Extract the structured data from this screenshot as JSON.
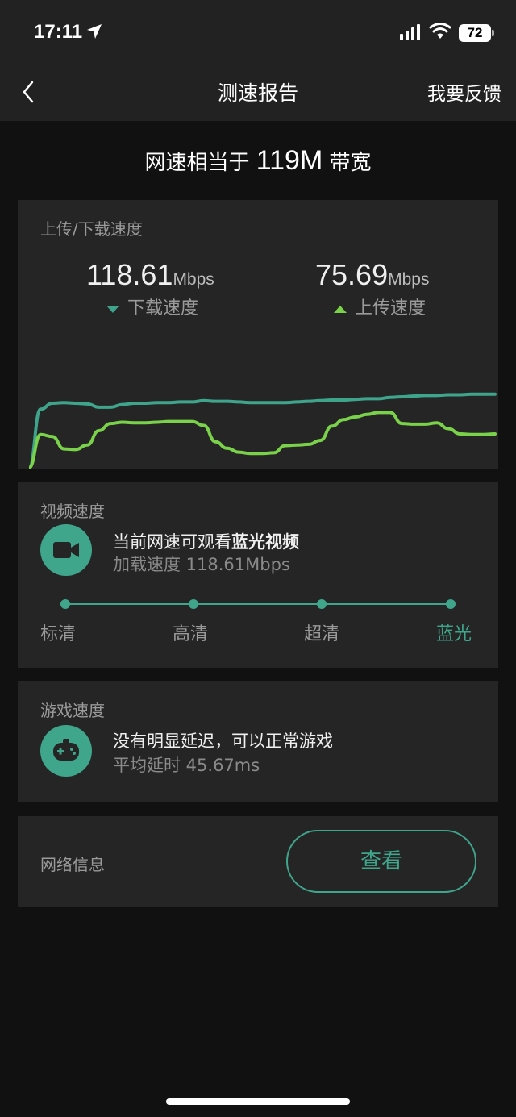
{
  "status_bar": {
    "time": "17:11",
    "battery": "72"
  },
  "nav": {
    "title": "测速报告",
    "feedback": "我要反馈"
  },
  "headline": {
    "prefix": "网速相当于 ",
    "bandwidth": "119M",
    "suffix": " 带宽"
  },
  "speed_card": {
    "title": "上传/下载速度",
    "download": {
      "value": "118.61",
      "unit": "Mbps",
      "label": "下载速度"
    },
    "upload": {
      "value": "75.69",
      "unit": "Mbps",
      "label": "上传速度"
    }
  },
  "chart_data": {
    "type": "line",
    "title": "",
    "xlabel": "",
    "ylabel": "",
    "x": [
      0,
      1,
      2,
      3,
      4,
      5,
      6,
      7,
      8,
      9,
      10,
      11,
      12,
      13,
      14,
      15,
      16,
      17,
      18,
      19,
      20,
      21,
      22,
      23,
      24,
      25,
      26,
      27,
      28,
      29,
      30,
      31,
      32,
      33,
      34,
      35,
      36,
      37,
      38,
      39,
      40
    ],
    "series": [
      {
        "name": "下载速度",
        "color": "#3ea58c",
        "values": [
          0,
          90,
          99,
          100,
          99,
          98,
          93,
          93,
          97,
          99,
          99,
          100,
          100,
          101,
          101,
          103,
          102,
          102,
          101,
          100,
          100,
          100,
          100,
          101,
          102,
          103,
          104,
          104,
          105,
          106,
          106,
          108,
          109,
          110,
          111,
          111,
          112,
          112,
          113,
          113,
          113
        ]
      },
      {
        "name": "上传速度",
        "color": "#7ad14a",
        "values": [
          0,
          51,
          48,
          29,
          28,
          35,
          57,
          68,
          70,
          69,
          69,
          70,
          71,
          71,
          71,
          65,
          40,
          30,
          24,
          22,
          22,
          23,
          34,
          35,
          36,
          42,
          64,
          74,
          78,
          82,
          85,
          85,
          68,
          67,
          67,
          69,
          60,
          52,
          51,
          51,
          52
        ]
      }
    ],
    "ylim": [
      0,
      130
    ],
    "grid": false,
    "legend": "none"
  },
  "video_card": {
    "title": "视频速度",
    "main_prefix": "当前网速可观看",
    "main_bold": "蓝光视频",
    "sub": "加载速度 118.61Mbps",
    "levels": [
      "标清",
      "高清",
      "超清",
      "蓝光"
    ],
    "current_level": "蓝光"
  },
  "game_card": {
    "title": "游戏速度",
    "main": "没有明显延迟，可以正常游戏",
    "sub": "平均延时 45.67ms"
  },
  "net_card": {
    "label": "网络信息",
    "button": "查看"
  },
  "icons": {
    "back": "chevron-left-icon",
    "video": "video-camera-icon",
    "game": "gamepad-icon"
  },
  "colors": {
    "accent": "#3fa58b",
    "upload_line": "#7ad14a",
    "background": "#111111",
    "card": "#252525"
  }
}
